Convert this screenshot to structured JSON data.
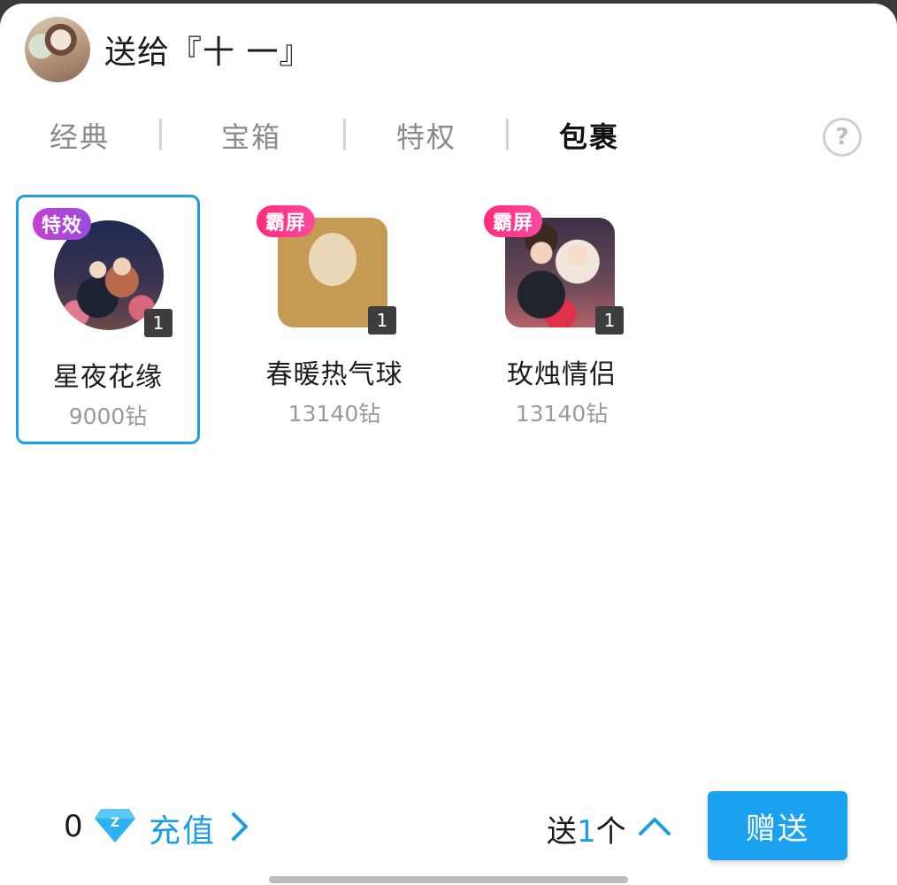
{
  "header": {
    "title": "送给『十 一』"
  },
  "tabs": [
    {
      "label": "经典",
      "active": false
    },
    {
      "label": "宝箱",
      "active": false
    },
    {
      "label": "特权",
      "active": false
    },
    {
      "label": "包裹",
      "active": true
    }
  ],
  "help": {
    "label": "?"
  },
  "gifts": [
    {
      "tag": "特效",
      "count": "1",
      "name": "星夜花缘",
      "price": "9000钻",
      "selected": true
    },
    {
      "tag": "霸屏",
      "count": "1",
      "name": "春暖热气球",
      "price": "13140钻",
      "selected": false
    },
    {
      "tag": "霸屏",
      "count": "1",
      "name": "玫烛情侣",
      "price": "13140钻",
      "selected": false
    }
  ],
  "bottom": {
    "balance": "0",
    "currency_icon": "diamond-icon",
    "recharge_label": "充值",
    "send_prefix": "送",
    "send_qty": "1",
    "send_unit": "个",
    "send_button_label": "赠送"
  },
  "colors": {
    "accent": "#1aa2f0",
    "effect_tag": "#b146d6",
    "screen_tag": "#ff2f80"
  }
}
